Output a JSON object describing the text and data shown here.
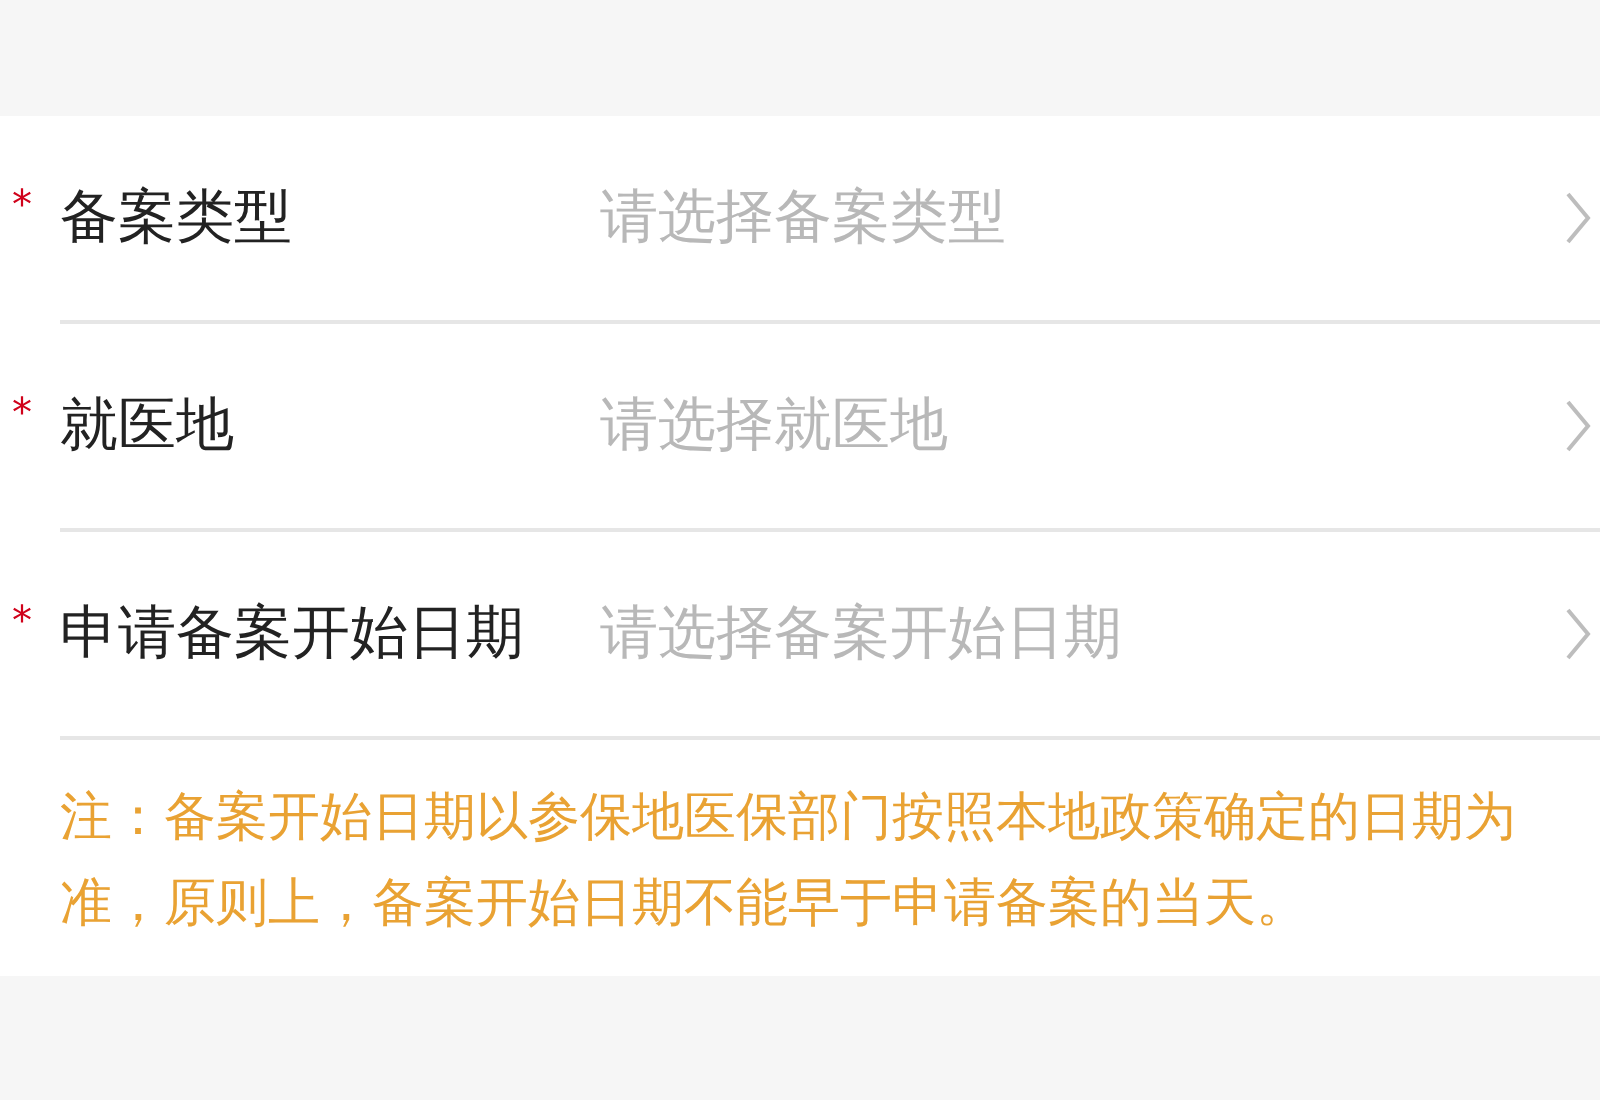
{
  "fields": [
    {
      "label": "备案类型",
      "placeholder": "请选择备案类型",
      "required": true
    },
    {
      "label": "就医地",
      "placeholder": "请选择就医地",
      "required": true
    },
    {
      "label": "申请备案开始日期",
      "placeholder": "请选择备案开始日期",
      "required": true
    }
  ],
  "required_mark": "*",
  "note": "注：备案开始日期以参保地医保部门按照本地政策确定的日期为准，原则上，备案开始日期不能早于申请备案的当天。"
}
